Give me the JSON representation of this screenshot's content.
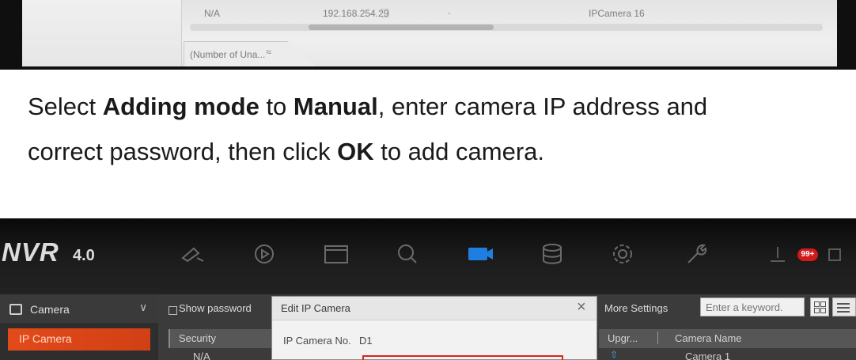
{
  "list_fragment": {
    "row": {
      "security": "N/A",
      "ip": "192.168.254.29",
      "dash": "-",
      "name": "IPCamera 16"
    },
    "unadded_tab": "(Number of Una...",
    "unadded_chevron": "≈"
  },
  "instruction": {
    "line1_a": "Select ",
    "line1_b": "Adding mode",
    "line1_c": " to ",
    "line1_d": "Manual",
    "line1_e": ", enter camera IP  address and",
    "line2_a": "correct password, then click ",
    "line2_b": "OK",
    "line2_c": " to add camera."
  },
  "nvr": {
    "logo": "NVR",
    "version": "4.0",
    "badge": "99+",
    "sidebar": {
      "camera": "Camera",
      "chevron": "∨",
      "ip_camera": "IP Camera"
    },
    "show_password": "Show password",
    "security_header": "Security",
    "security_value": "N/A",
    "dialog": {
      "title": "Edit IP Camera",
      "close": "×",
      "ip_no_label": "IP Camera No.",
      "ip_no_value": "D1"
    },
    "more_settings": "More Settings",
    "keyword_placeholder": "Enter a keyword.",
    "table": {
      "upgrade_header": "Upgr...",
      "name_header": "Camera Name",
      "upgrade_icon": "⇧",
      "name_value": "Camera 1"
    }
  },
  "colors": {
    "accent_orange": "#e24a1a",
    "highlight_red": "#d8261d",
    "nav_active_blue": "#1f7fe0",
    "badge_red": "#d11a1a"
  }
}
